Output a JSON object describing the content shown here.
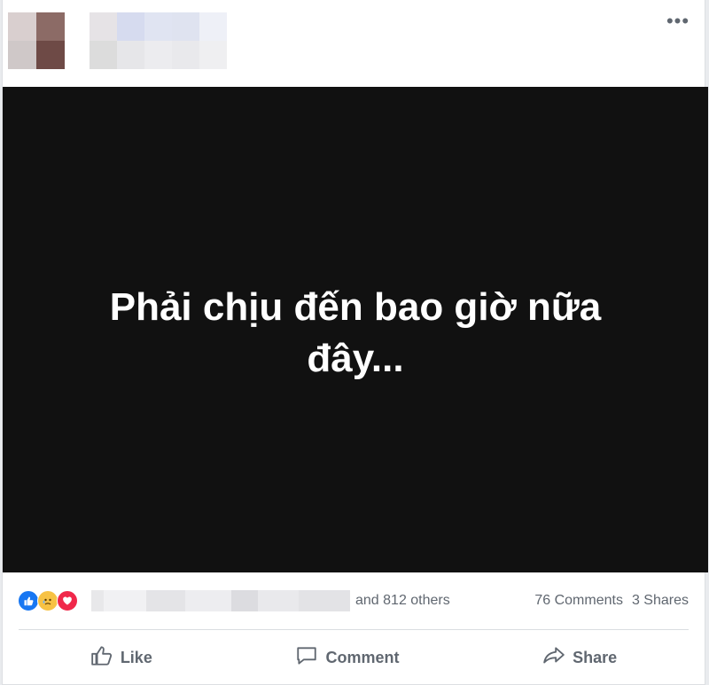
{
  "header": {
    "more_label": "•••"
  },
  "post": {
    "text": "Phải chịu đến bao giờ nữa đây..."
  },
  "stats": {
    "reactions": [
      "like-icon",
      "sad-icon",
      "love-icon"
    ],
    "blurred_first_letter": "D",
    "others_text": "and 812 others",
    "comments_text": "76 Comments",
    "shares_text": "3 Shares"
  },
  "actions": {
    "like_label": "Like",
    "comment_label": "Comment",
    "share_label": "Share"
  },
  "colors": {
    "brand_blue": "#1877f2",
    "love_red": "#f0284a",
    "sad_yellow": "#f7c244",
    "meta_gray": "#606770",
    "image_bg": "#111111"
  }
}
